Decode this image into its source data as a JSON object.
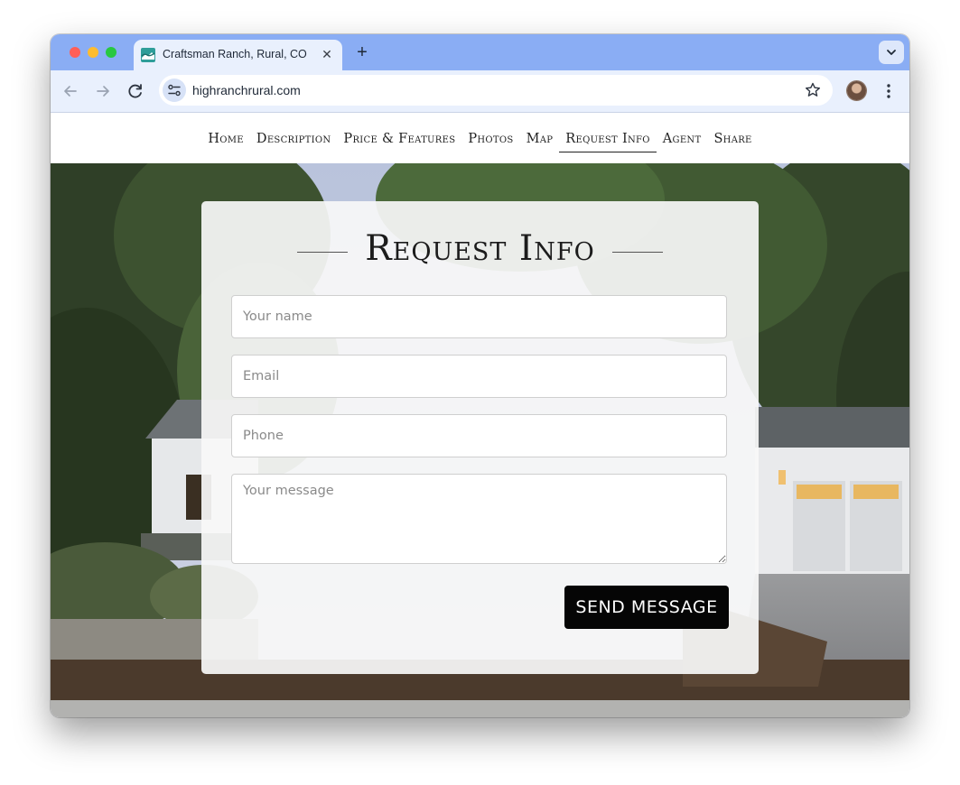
{
  "browser": {
    "tab_title": "Craftsman Ranch, Rural, CO",
    "tab_close": "✕",
    "new_tab": "+",
    "url": "highranchrural.com"
  },
  "nav": {
    "items": [
      {
        "label": "Home"
      },
      {
        "label": "Description"
      },
      {
        "label": "Price & Features"
      },
      {
        "label": "Photos"
      },
      {
        "label": "Map"
      },
      {
        "label": "Request Info",
        "active": true
      },
      {
        "label": "Agent"
      },
      {
        "label": "Share"
      }
    ]
  },
  "form": {
    "title": "Request Info",
    "name_placeholder": "Your name",
    "email_placeholder": "Email",
    "phone_placeholder": "Phone",
    "message_placeholder": "Your message",
    "submit_label": "SEND MESSAGE"
  },
  "colors": {
    "tabstrip": "#8aadf4",
    "toolbar": "#e9f0fd",
    "button": "#050505"
  },
  "icons": {
    "back": "arrow-left-icon",
    "forward": "arrow-right-icon",
    "reload": "reload-icon",
    "site_settings": "tune-icon",
    "bookmark": "star-icon",
    "menu": "kebab-icon"
  }
}
